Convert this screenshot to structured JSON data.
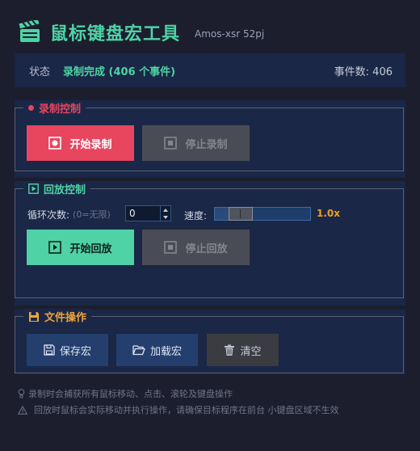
{
  "app": {
    "title": "鼠标键盘宏工具",
    "author": "Amos-xsr 52pj"
  },
  "status": {
    "label": "状态",
    "value": "录制完成 (406 个事件)",
    "event_count": "事件数: 406"
  },
  "record": {
    "legend": "录制控制",
    "start_label": "开始录制",
    "stop_label": "停止录制"
  },
  "playback": {
    "legend": "回放控制",
    "loop_label": "循环次数:",
    "loop_hint": "(0=无限)",
    "loop_value": "0",
    "speed_label": "速度:",
    "speed_value": "1.0x",
    "speed_fraction": 0.1,
    "start_label": "开始回放",
    "stop_label": "停止回放"
  },
  "file": {
    "legend": "文件操作",
    "save_label": "保存宏",
    "load_label": "加载宏",
    "clear_label": "清空"
  },
  "tips": [
    "录制时会捕获所有鼠标移动、点击、滚轮及键盘操作",
    "回放时鼠标会实际移动并执行操作，请确保目标程序在前台  小键盘区域不生效"
  ],
  "colors": {
    "accent_green": "#4fd2a5",
    "record_red": "#e8455f",
    "file_orange": "#f0a33a",
    "speed_orange": "#f0a020"
  }
}
